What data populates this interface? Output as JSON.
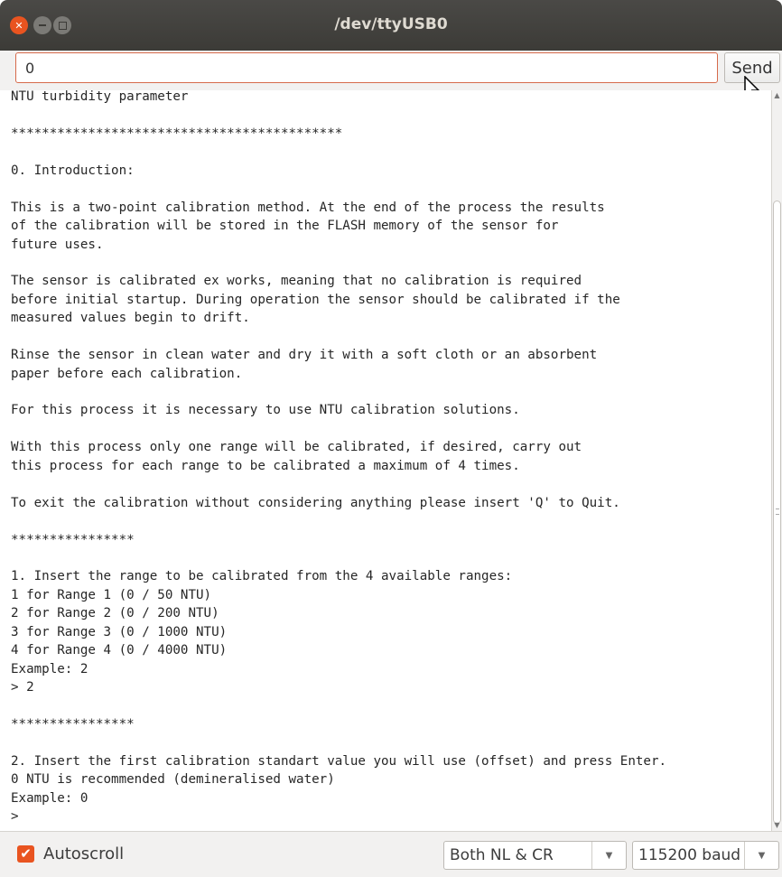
{
  "window": {
    "title": "/dev/ttyUSB0"
  },
  "input": {
    "value": "0",
    "send_label": "Send"
  },
  "output_lines": [
    "NTU turbidity parameter",
    "",
    "*******************************************",
    "",
    "0. Introduction:",
    "",
    "This is a two-point calibration method. At the end of the process the results",
    "of the calibration will be stored in the FLASH memory of the sensor for",
    "future uses.",
    "",
    "The sensor is calibrated ex works, meaning that no calibration is required",
    "before initial startup. During operation the sensor should be calibrated if the",
    "measured values begin to drift.",
    "",
    "Rinse the sensor in clean water and dry it with a soft cloth or an absorbent",
    "paper before each calibration.",
    "",
    "For this process it is necessary to use NTU calibration solutions.",
    "",
    "With this process only one range will be calibrated, if desired, carry out",
    "this process for each range to be calibrated a maximum of 4 times.",
    "",
    "To exit the calibration without considering anything please insert 'Q' to Quit.",
    "",
    "****************",
    "",
    "1. Insert the range to be calibrated from the 4 available ranges:",
    "1 for Range 1 (0 / 50 NTU)",
    "2 for Range 2 (0 / 200 NTU)",
    "3 for Range 3 (0 / 1000 NTU)",
    "4 for Range 4 (0 / 4000 NTU)",
    "Example: 2",
    "> 2",
    "",
    "****************",
    "",
    "2. Insert the first calibration standart value you will use (offset) and press Enter.",
    "0 NTU is recommended (demineralised water)",
    "Example: 0",
    ">"
  ],
  "footer": {
    "autoscroll_label": "Autoscroll",
    "autoscroll_checked": true,
    "line_ending": "Both NL & CR",
    "baud": "115200 baud"
  },
  "colors": {
    "accent": "#e95420",
    "titlebar": "#3c3b37"
  },
  "icons": [
    "close-icon",
    "minimize-icon",
    "maximize-icon",
    "mouse-cursor-icon",
    "checkmark-icon",
    "chevron-down-icon"
  ]
}
